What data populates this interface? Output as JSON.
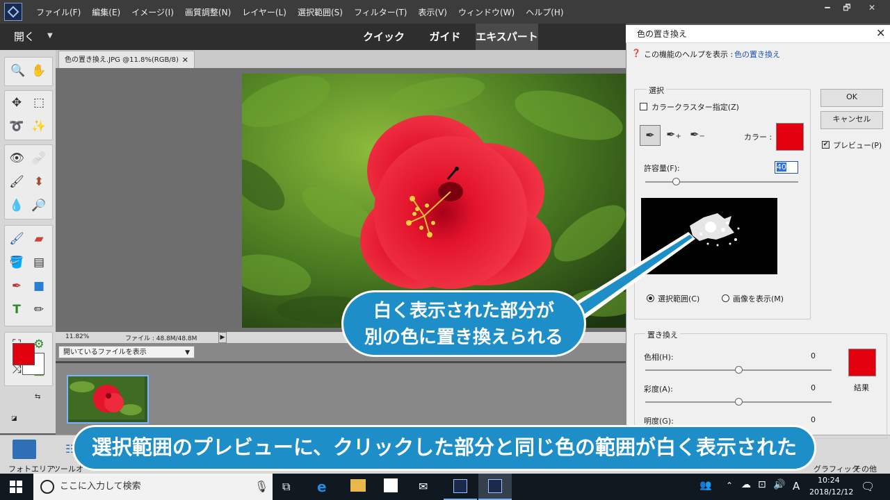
{
  "menu": {
    "items": [
      "ファイル(F)",
      "編集(E)",
      "イメージ(I)",
      "画質調整(N)",
      "レイヤー(L)",
      "選択範囲(S)",
      "フィルター(T)",
      "表示(V)",
      "ウィンドウ(W)",
      "ヘルプ(H)"
    ]
  },
  "window_controls": {
    "minimize": "━",
    "restore": "🗗",
    "close": "✕"
  },
  "modebar": {
    "open_label": "開く",
    "tabs": [
      "クイック",
      "ガイド",
      "エキスパート"
    ],
    "active_tab": "エキスパート"
  },
  "document": {
    "tab_title": "色の置き換え.JPG @11.8%(RGB/8)",
    "tab_close": "✕",
    "zoom": "11.82%",
    "file_info": "ファイル : 48.8M/48.8M"
  },
  "photo_bin": {
    "dropdown_value": "開いているファイルを表示"
  },
  "bottom_panel": {
    "left": [
      "フォトエリア",
      "ツールオ"
    ],
    "right": [
      "グラフィック",
      "その他"
    ]
  },
  "dialog": {
    "title": "色の置き換え",
    "help_prefix": "この機能のヘルプを表示 :",
    "help_link": "色の置き換え",
    "selection_group": "選択",
    "color_cluster_label": "カラークラスター指定(Z)",
    "color_cluster_checked": false,
    "color_label": "カラー :",
    "selected_color": "#e3000f",
    "tolerance_label": "許容量(F):",
    "tolerance_value": "40",
    "tolerance_slider_pct": 0.2,
    "radio_selection": "選択範囲(C)",
    "radio_image": "画像を表示(M)",
    "radio_selected": "selection",
    "ok_label": "OK",
    "cancel_label": "キャンセル",
    "preview_label": "プレビュー(P)",
    "preview_checked": true,
    "replace_group": "置き換え",
    "hue_label": "色相(H):",
    "hue_value": "0",
    "saturation_label": "彩度(A):",
    "saturation_value": "0",
    "lightness_label": "明度(G):",
    "lightness_value": "0",
    "result_label": "結果",
    "result_color": "#e3000f"
  },
  "callouts": {
    "line1": "白く表示された部分が",
    "line2": "別の色に置き換えられる",
    "caption": "選択範囲のプレビューに、クリックした部分と同じ色の範囲が白く表示された"
  },
  "taskbar": {
    "search_placeholder": "ここに入力して検索",
    "ime": "A",
    "time": "10:24",
    "date": "2018/12/12"
  },
  "colors": {
    "foreground": "#e0000e",
    "background": "#ffffff",
    "callout": "#1e8ec8"
  }
}
